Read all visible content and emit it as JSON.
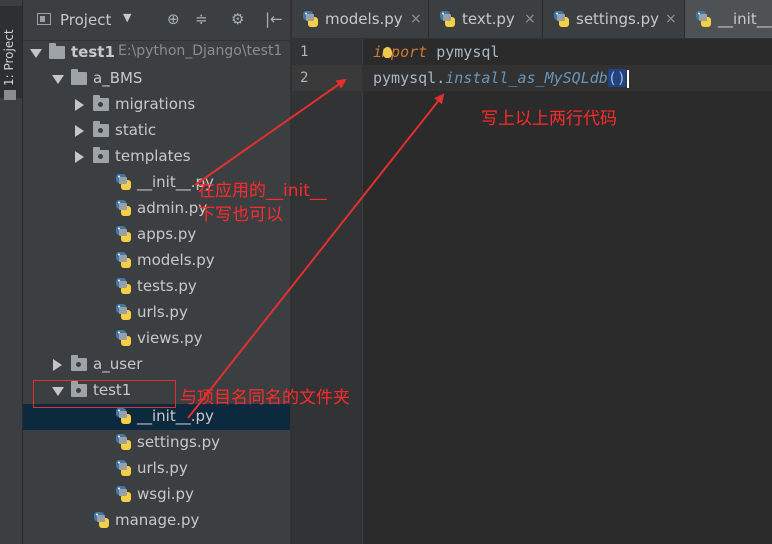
{
  "toolstrip": {
    "project_tab": "1: Project"
  },
  "panel": {
    "title": "Project",
    "tools": [
      "⊕",
      "≑",
      "⚙",
      "|←"
    ]
  },
  "tree": [
    {
      "label": "test1",
      "path": "E:\\python_Django\\test1",
      "type": "folder",
      "expanded": true,
      "bold": true
    },
    {
      "label": "a_BMS",
      "type": "folder",
      "expanded": true
    },
    {
      "label": "migrations",
      "type": "folder",
      "expanded": false
    },
    {
      "label": "static",
      "type": "folder",
      "expanded": false
    },
    {
      "label": "templates",
      "type": "folder",
      "expanded": false
    },
    {
      "label": "__init__.py",
      "type": "py"
    },
    {
      "label": "admin.py",
      "type": "py"
    },
    {
      "label": "apps.py",
      "type": "py"
    },
    {
      "label": "models.py",
      "type": "py"
    },
    {
      "label": "tests.py",
      "type": "py"
    },
    {
      "label": "urls.py",
      "type": "py"
    },
    {
      "label": "views.py",
      "type": "py"
    },
    {
      "label": "a_user",
      "type": "folder",
      "expanded": false
    },
    {
      "label": "test1",
      "type": "folder",
      "expanded": true
    },
    {
      "label": "__init__.py",
      "type": "py",
      "selected": true
    },
    {
      "label": "settings.py",
      "type": "py"
    },
    {
      "label": "urls.py",
      "type": "py"
    },
    {
      "label": "wsgi.py",
      "type": "py"
    },
    {
      "label": "manage.py",
      "type": "py"
    }
  ],
  "tabs": [
    {
      "label": "models.py",
      "close": "×"
    },
    {
      "label": "text.py",
      "close": "×"
    },
    {
      "label": "settings.py",
      "close": "×"
    },
    {
      "label": "__init__.py",
      "close": "×",
      "active": true
    }
  ],
  "editor": {
    "lines": [
      {
        "no": "1",
        "keyword": "import",
        "rest": " pymysql"
      },
      {
        "no": "2",
        "obj": "pymysql.",
        "call": "install_as_MySQLdb",
        "parens": "()"
      }
    ]
  },
  "annotations": {
    "code_note": "写上以上两行代码",
    "app_note_line1": "在应用的__init__",
    "app_note_line2": "下写也可以",
    "folder_note": "与项目名同名的文件夹"
  },
  "colors": {
    "annotation": "#ff2b2b",
    "keyword": "#cc7832",
    "method": "#6897bb",
    "selection": "#0d293e"
  }
}
